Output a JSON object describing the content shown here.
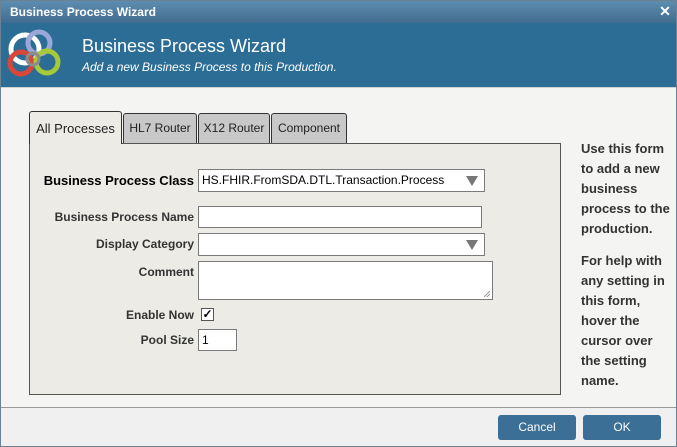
{
  "window": {
    "title": "Business Process Wizard",
    "close_icon": "close-icon"
  },
  "header": {
    "title": "Business Process Wizard",
    "subtitle": "Add a new Business Process to this Production."
  },
  "tabs": [
    {
      "label": "All Processes",
      "active": true
    },
    {
      "label": "HL7 Router",
      "active": false
    },
    {
      "label": "X12 Router",
      "active": false
    },
    {
      "label": "Component",
      "active": false
    }
  ],
  "form": {
    "class_label": "Business Process Class",
    "class_value": "HS.FHIR.FromSDA.DTL.Transaction.Process",
    "name_label": "Business Process Name",
    "name_value": "",
    "category_label": "Display Category",
    "category_value": "",
    "comment_label": "Comment",
    "comment_value": "",
    "enable_label": "Enable Now",
    "enable_checked": true,
    "pool_label": "Pool Size",
    "pool_value": "1"
  },
  "help": {
    "para1": "Use this form to add a new business process to the production.",
    "para2": "For help with any setting in this form, hover the cursor over the setting name."
  },
  "buttons": {
    "cancel": "Cancel",
    "ok": "OK"
  },
  "colors": {
    "header_bg": "#2c6d95",
    "titlebar_bg": "#4f7ea2",
    "button_bg": "#3b6f95",
    "panel_bg": "#ecebe6"
  }
}
